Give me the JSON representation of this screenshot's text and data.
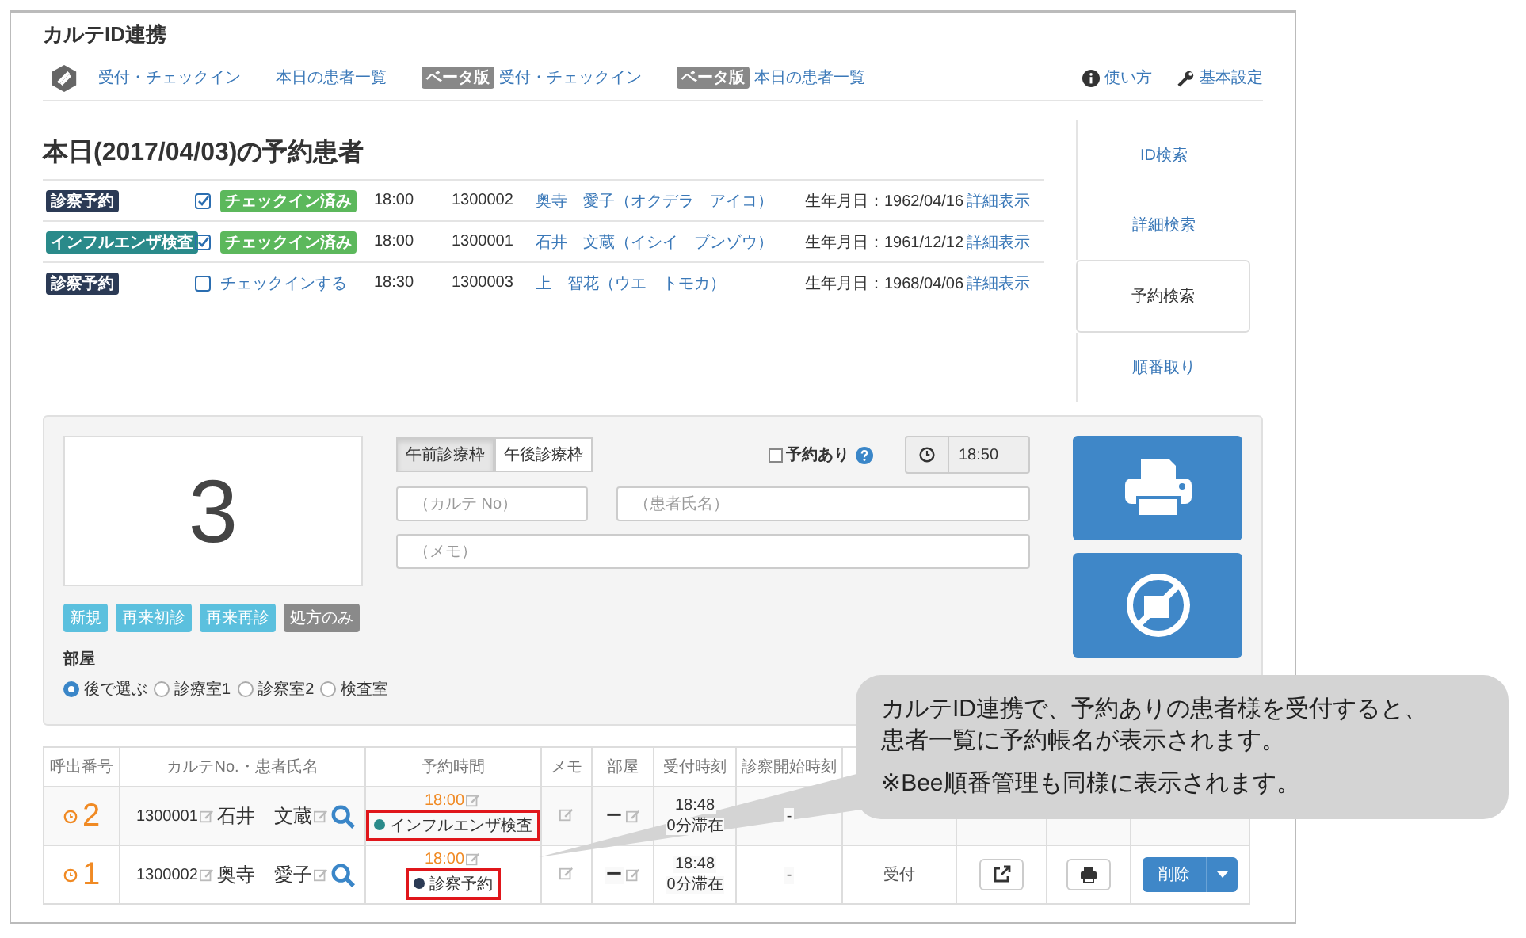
{
  "app_title": "カルテID連携",
  "nav": {
    "links": [
      {
        "label": "受付・チェックイン"
      },
      {
        "label": "本日の患者一覧"
      },
      {
        "label": "受付・チェックイン",
        "badge": "ベータ版"
      },
      {
        "label": "本日の患者一覧",
        "badge": "ベータ版"
      }
    ],
    "help": "使い方",
    "settings": "基本設定"
  },
  "heading": "本日(2017/04/03)の予約患者",
  "appointments": [
    {
      "type": "診察予約",
      "color": "#2b3a55",
      "checked_in": true,
      "status": "チェックイン済み",
      "time": "18:00",
      "id": "1300002",
      "name": "奥寺　愛子（オクデラ　アイコ）",
      "birth": "生年月日：1962/04/16",
      "detail": "詳細表示"
    },
    {
      "type": "インフルエンザ検査",
      "color": "#2a8a8a",
      "checked_in": true,
      "status": "チェックイン済み",
      "time": "18:00",
      "id": "1300001",
      "name": "石井　文蔵（イシイ　ブンゾウ）",
      "birth": "生年月日：1961/12/12",
      "detail": "詳細表示"
    },
    {
      "type": "診察予約",
      "color": "#2b3a55",
      "checked_in": false,
      "status": "チェックインする",
      "time": "18:30",
      "id": "1300003",
      "name": "上　智花（ウエ　トモカ）",
      "birth": "生年月日：1968/04/06",
      "detail": "詳細表示"
    }
  ],
  "side_tabs": [
    {
      "label": "ID検索",
      "selected": false
    },
    {
      "label": "詳細検索",
      "selected": false
    },
    {
      "label": "予約検索",
      "selected": true
    },
    {
      "label": "順番取り",
      "selected": false
    }
  ],
  "reception": {
    "number": "3",
    "slots": [
      {
        "label": "午前診療枠",
        "selected": true
      },
      {
        "label": "午後診療枠",
        "selected": false
      }
    ],
    "reservation": {
      "label": "予約あり",
      "checked": false
    },
    "time": "18:50",
    "karte_placeholder": "（カルテ No）",
    "name_placeholder": "（患者氏名）",
    "memo_placeholder": "（メモ）",
    "visit_buttons": [
      {
        "label": "新規",
        "kind": "info"
      },
      {
        "label": "再来初診",
        "kind": "info"
      },
      {
        "label": "再来再診",
        "kind": "info"
      },
      {
        "label": "処方のみ",
        "kind": "muted"
      }
    ],
    "room_label": "部屋",
    "rooms": [
      {
        "label": "後で選ぶ",
        "selected": true
      },
      {
        "label": "診療室1",
        "selected": false
      },
      {
        "label": "診察室2",
        "selected": false
      },
      {
        "label": "検査室",
        "selected": false
      }
    ]
  },
  "queue": {
    "columns": [
      "呼出番号",
      "カルテNo.・患者氏名",
      "予約時間",
      "メモ",
      "部屋",
      "受付時刻",
      "診察開始時刻"
    ],
    "rows": [
      {
        "number": "2",
        "id": "1300001",
        "name": "石井　文蔵",
        "time": "18:00",
        "tag": {
          "label": "インフルエンザ検査",
          "color": "#2a8a8a"
        },
        "room": "ー",
        "reception_time": "18:48",
        "stay": "0分滞在",
        "start": "-"
      },
      {
        "number": "1",
        "id": "1300002",
        "name": "奥寺　愛子",
        "time": "18:00",
        "tag": {
          "label": "診察予約",
          "color": "#2b3a55"
        },
        "room": "ー",
        "reception_time": "18:48",
        "stay": "0分滞在",
        "start": "-",
        "status": "受付",
        "action": "削除"
      }
    ]
  },
  "callout": {
    "paragraphs": [
      "カルテID連携で、予約ありの患者様を受付すると、患者一覧に予約帳名が表示されます。",
      "※Bee順番管理も同様に表示されます。"
    ]
  }
}
